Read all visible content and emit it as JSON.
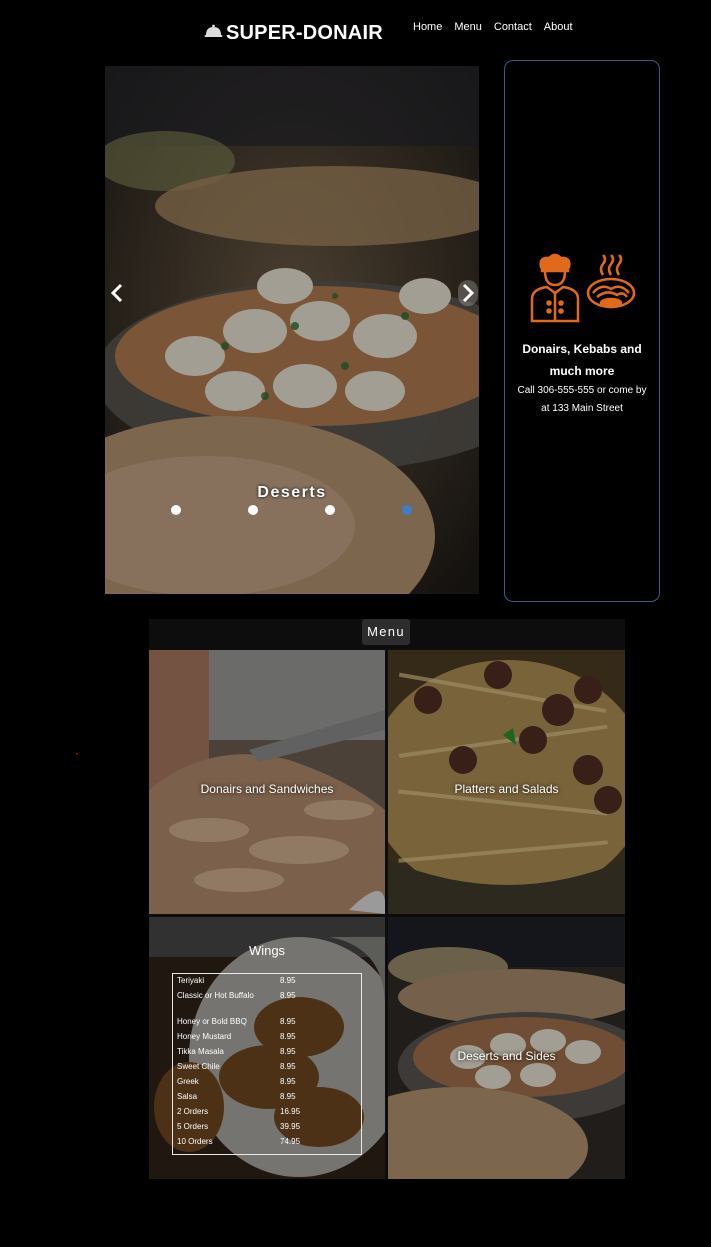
{
  "header": {
    "brand": "SUPER-DONAIR",
    "nav": [
      "Home",
      "Menu",
      "Contact",
      "About"
    ]
  },
  "carousel": {
    "caption": "Deserts",
    "slide_count": 4,
    "active_index": 3
  },
  "info": {
    "title": "Donairs, Kebabs and much more",
    "text": "Call 306-555-555 or come by at 133 Main Street",
    "icon_color": "#e06a1a"
  },
  "menu": {
    "heading": "Menu",
    "tiles": [
      {
        "label": "Donairs and Sandwiches"
      },
      {
        "label": "Platters and Salads"
      },
      {
        "label": "Wings"
      },
      {
        "label": "Deserts and Sides"
      }
    ],
    "wings": [
      {
        "name": "Teriyaki",
        "price": "8.95"
      },
      {
        "name": "Classic or Hot Buffalo",
        "price": "8.95"
      },
      {
        "name": "Honey or Bold BBQ",
        "price": "8.95"
      },
      {
        "name": "Honey Mustard",
        "price": "8.95"
      },
      {
        "name": "Tikka Masala",
        "price": "8.95"
      },
      {
        "name": "Sweet Chile",
        "price": "8.95"
      },
      {
        "name": "Greek",
        "price": "8.95"
      },
      {
        "name": "Salsa",
        "price": "8.95"
      },
      {
        "name": "2 Orders",
        "price": "16.95"
      },
      {
        "name": "5 Orders",
        "price": "39.95"
      },
      {
        "name": "10 Orders",
        "price": "74.95"
      }
    ]
  },
  "colors": {
    "accent_dot": "#3f7dc4",
    "card_border": "#3a5a8c"
  }
}
